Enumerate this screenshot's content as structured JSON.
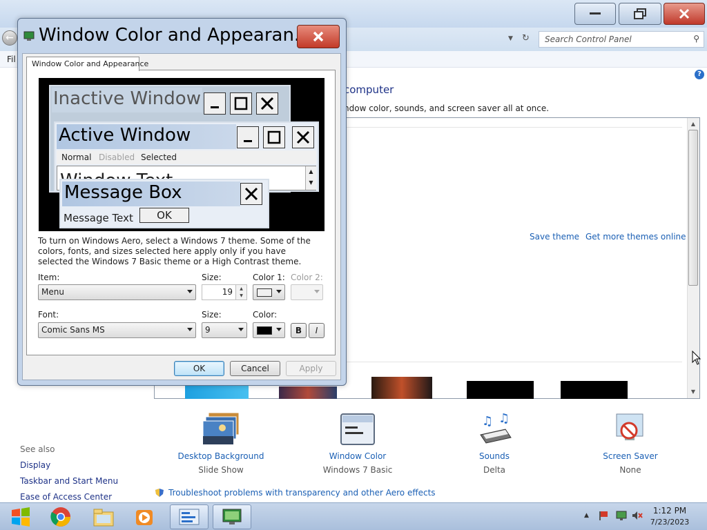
{
  "background_window": {
    "search_placeholder": "Search Control Panel",
    "menu_file": "Fil",
    "heading": "computer",
    "subtext": "ndow color, sounds, and screen saver all at once.",
    "save_theme": "Save theme",
    "get_more_themes": "Get more themes online",
    "options": [
      {
        "title": "Desktop Background",
        "subtitle": "Slide Show",
        "icon": "desktop-background-icon"
      },
      {
        "title": "Window Color",
        "subtitle": "Windows 7 Basic",
        "icon": "window-color-icon"
      },
      {
        "title": "Sounds",
        "subtitle": "Delta",
        "icon": "sounds-icon"
      },
      {
        "title": "Screen Saver",
        "subtitle": "None",
        "icon": "screen-saver-icon"
      }
    ],
    "see_also": {
      "label": "See also",
      "links": [
        "Display",
        "Taskbar and Start Menu",
        "Ease of Access Center"
      ]
    },
    "troubleshoot_link": "Troubleshoot problems with transparency and other Aero effects"
  },
  "dialog": {
    "title": "Window Color and Appearan...",
    "tab": "Window Color and Appearance",
    "preview": {
      "inactive_window": "Inactive Window",
      "active_window": "Active Window",
      "menu_normal": "Normal",
      "menu_disabled": "Disabled",
      "menu_selected": "Selected",
      "window_text": "Window Text",
      "message_box": "Message Box",
      "message_text": "Message Text",
      "ok": "OK"
    },
    "description": "To turn on Windows Aero, select a Windows 7 theme.  Some of the colors, fonts, and sizes selected here apply only if you have selected the Windows 7 Basic theme or a High Contrast theme.",
    "item_label": "Item:",
    "item_value": "Menu",
    "size_label": "Size:",
    "item_size": "19",
    "color1_label": "Color 1:",
    "color1_value": "#f0f0f0",
    "color2_label": "Color 2:",
    "font_label": "Font:",
    "font_value": "Comic Sans MS",
    "font_size_label": "Size:",
    "font_size": "9",
    "font_color_label": "Color:",
    "font_color_value": "#000000",
    "bold": "B",
    "italic": "I",
    "ok": "OK",
    "cancel": "Cancel",
    "apply": "Apply"
  },
  "taskbar": {
    "time": "1:12 PM",
    "date": "7/23/2023",
    "pinned": [
      "start-button",
      "chrome-icon",
      "file-explorer-icon",
      "media-player-icon",
      "control-panel-icon",
      "display-settings-icon"
    ]
  }
}
